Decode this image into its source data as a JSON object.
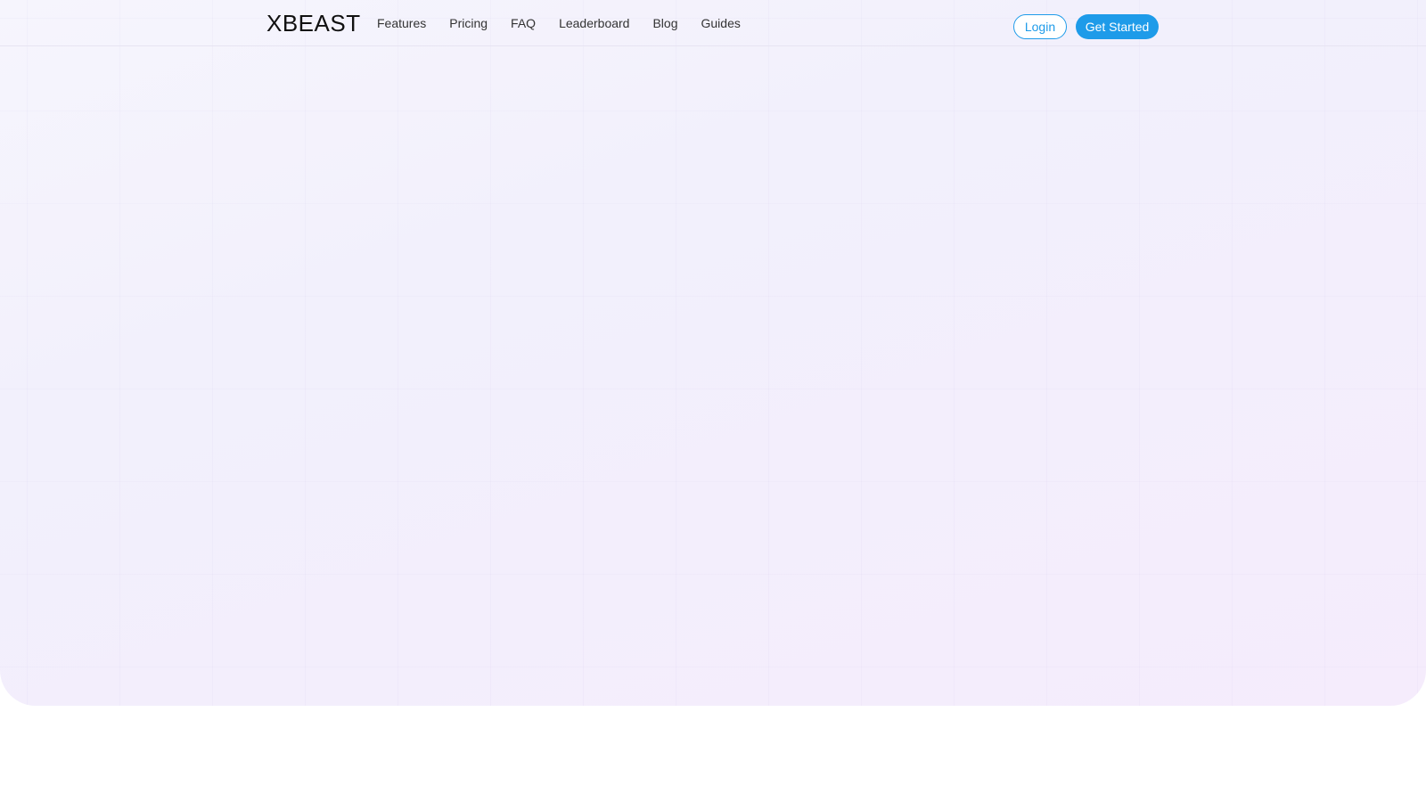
{
  "brand": {
    "logo_text": "XBEAST"
  },
  "nav": {
    "links": [
      {
        "label": "Features"
      },
      {
        "label": "Pricing"
      },
      {
        "label": "FAQ"
      },
      {
        "label": "Leaderboard"
      },
      {
        "label": "Blog"
      },
      {
        "label": "Guides"
      }
    ]
  },
  "actions": {
    "login_label": "Login",
    "get_started_label": "Get Started"
  },
  "colors": {
    "accent": "#1e9be9",
    "hero_bg": "#f3f0fc"
  }
}
